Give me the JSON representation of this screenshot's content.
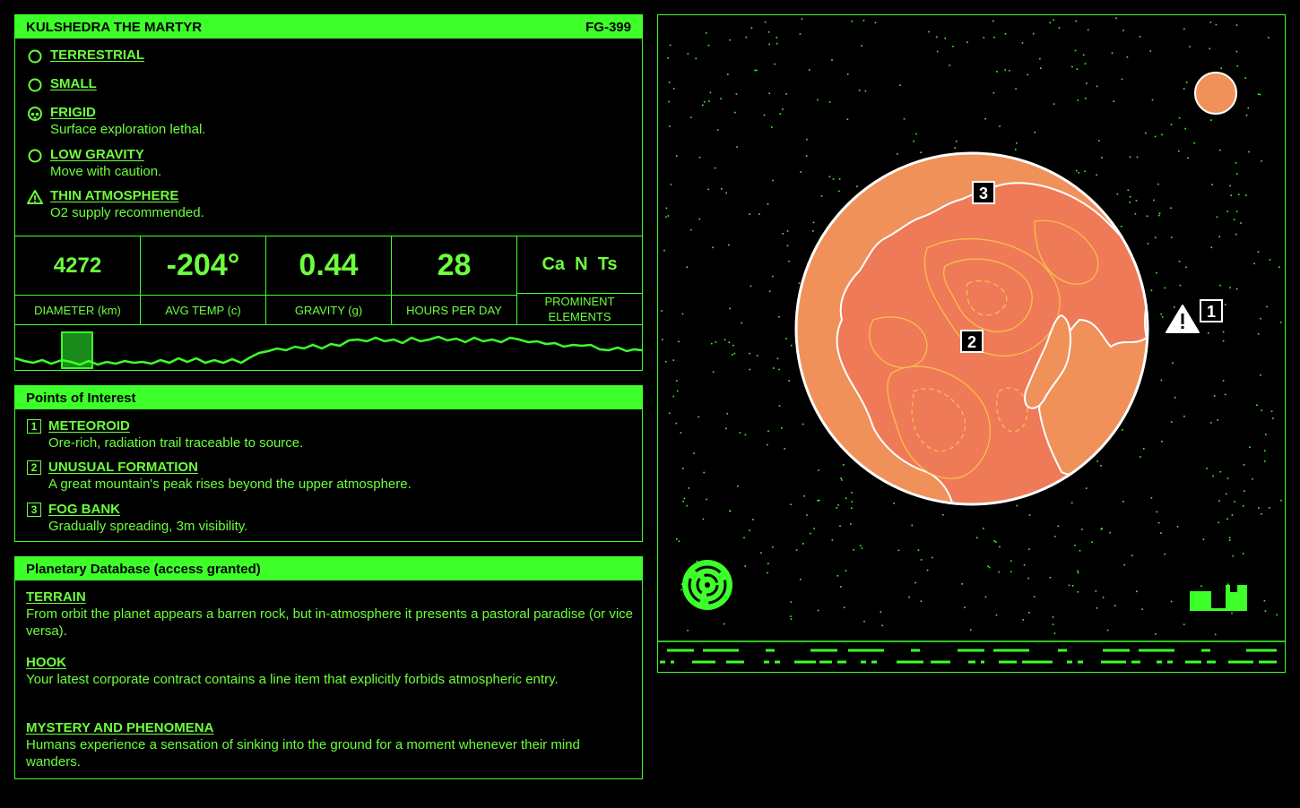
{
  "header": {
    "name": "KULSHEDRA THE MARTYR",
    "code": "FG-399"
  },
  "traits": [
    {
      "icon": "circle-icon",
      "title": "TERRESTRIAL",
      "desc": ""
    },
    {
      "icon": "circle-icon",
      "title": "SMALL",
      "desc": ""
    },
    {
      "icon": "skull-icon",
      "title": "FRIGID",
      "desc": "Surface exploration lethal."
    },
    {
      "icon": "circle-icon",
      "title": "LOW GRAVITY",
      "desc": "Move with caution."
    },
    {
      "icon": "warning-icon",
      "title": "THIN ATMOSPHERE",
      "desc": "O2 supply recommended."
    }
  ],
  "stats": [
    {
      "value": "4272",
      "label": "DIAMETER (km)"
    },
    {
      "value": "-204°",
      "label": "AVG TEMP (c)"
    },
    {
      "value": "0.44",
      "label": "GRAVITY (g)"
    },
    {
      "value": "28",
      "label": "HOURS PER DAY"
    },
    {
      "value": "Ca  N  Ts",
      "label": "PROMINENT ELEMENTS"
    }
  ],
  "poi": {
    "title": "Points of Interest",
    "items": [
      {
        "num": "1",
        "title": "METEOROID",
        "desc": "Ore-rich, radiation trail traceable to source."
      },
      {
        "num": "2",
        "title": "UNUSUAL FORMATION",
        "desc": "A great mountain's peak rises beyond the upper atmosphere."
      },
      {
        "num": "3",
        "title": "FOG BANK",
        "desc": "Gradually spreading, 3m visibility."
      }
    ]
  },
  "database": {
    "title": "Planetary Database (access granted)",
    "sections": [
      {
        "title": "TERRAIN",
        "text": "From orbit the planet appears a barren rock, but in-atmosphere it presents a pastoral paradise (or vice versa)."
      },
      {
        "title": "HOOK",
        "text": "Your latest corporate contract contains a line item that explicitly forbids atmospheric entry."
      },
      {
        "title": "MYSTERY AND PHENOMENA",
        "text": "Humans experience a sensation of sinking into the ground for a moment whenever their mind wanders."
      }
    ]
  },
  "map": {
    "markers": [
      "1",
      "2",
      "3"
    ],
    "colors": {
      "planet": "#f0915a",
      "moon": "#f0915a",
      "accent": "#3dff2a",
      "contour": "#f7c04a"
    }
  }
}
